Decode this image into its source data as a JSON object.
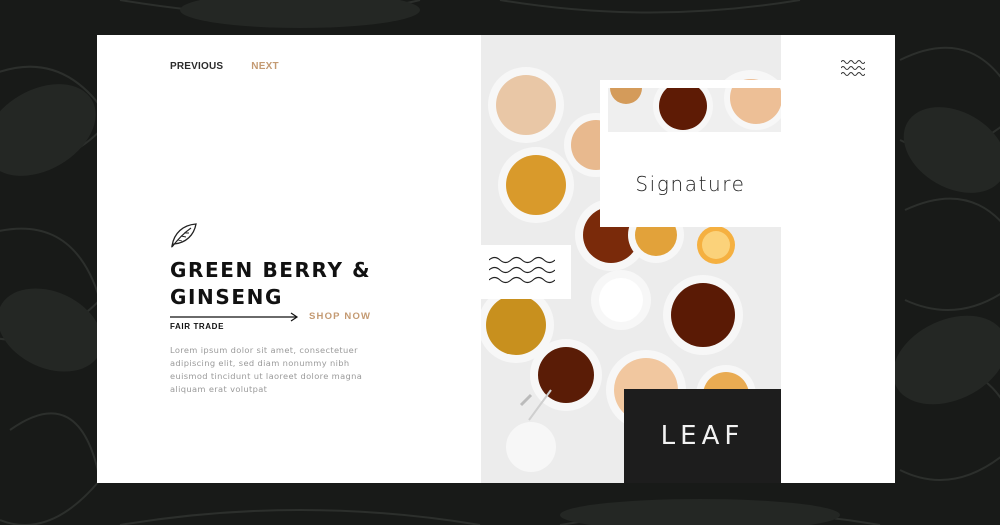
{
  "nav": {
    "previous_label": "PREVIOUS",
    "next_label": "NEXT"
  },
  "product": {
    "title_line1": "GREEN BERRY &",
    "title_line2": "GINSENG",
    "tag": "FAIR TRADE",
    "cta_label": "SHOP NOW",
    "description": "Lorem ipsum dolor sit amet, consectetuer adipiscing elit, sed diam nonummy nibh euismod tincidunt ut laoreet dolore magna aliquam erat volutpat"
  },
  "overlays": {
    "signature_label": "Signature",
    "leaf_label": "LEAF"
  },
  "icons": {
    "leaf": "leaf-icon",
    "arrow": "arrow-right-icon",
    "waves": "waves-icon",
    "menu": "menu-waves-icon"
  },
  "colors": {
    "accent": "#c49a72",
    "dark": "#1d1d1d",
    "text": "#111111",
    "muted": "#9a9a9a"
  }
}
